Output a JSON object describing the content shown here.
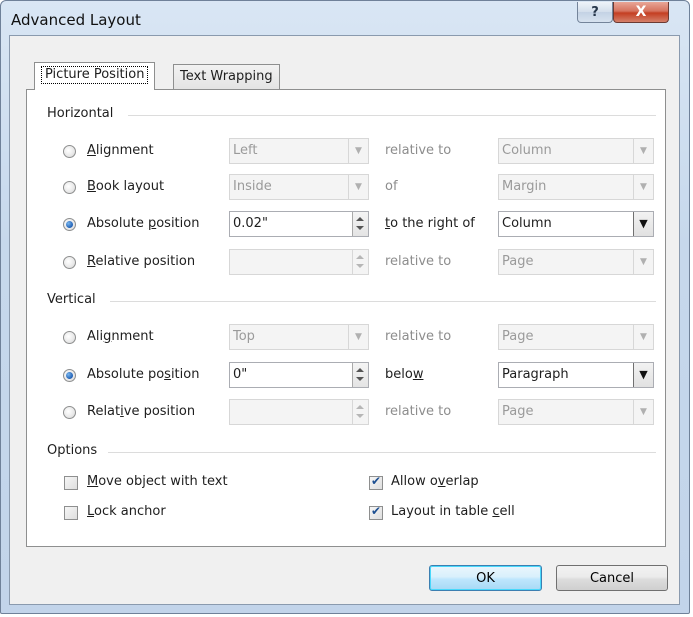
{
  "window": {
    "title": "Advanced Layout",
    "help_label": "?",
    "close_label": "X"
  },
  "tabs": [
    {
      "label": "Picture Position",
      "active": true
    },
    {
      "label": "Text Wrapping",
      "active": false
    }
  ],
  "horizontal": {
    "section_label": "Horizontal",
    "rows": [
      {
        "radio_label": "Alignment",
        "selected": false,
        "value": "Left",
        "relation": "relative to",
        "target": "Column",
        "enabled": false
      },
      {
        "radio_label": "Book layout",
        "selected": false,
        "value": "Inside",
        "relation": "of",
        "target": "Margin",
        "enabled": false
      },
      {
        "radio_label": "Absolute position",
        "selected": true,
        "value": "0.02\"",
        "relation": "to the right of",
        "target": "Column",
        "enabled": true
      },
      {
        "radio_label": "Relative position",
        "selected": false,
        "value": "",
        "relation": "relative to",
        "target": "Page",
        "enabled": false
      }
    ]
  },
  "vertical": {
    "section_label": "Vertical",
    "rows": [
      {
        "radio_label": "Alignment",
        "selected": false,
        "value": "Top",
        "relation": "relative to",
        "target": "Page",
        "enabled": false
      },
      {
        "radio_label": "Absolute position",
        "selected": true,
        "value": "0\"",
        "relation": "below",
        "target": "Paragraph",
        "enabled": true
      },
      {
        "radio_label": "Relative position",
        "selected": false,
        "value": "",
        "relation": "relative to",
        "target": "Page",
        "enabled": false
      }
    ]
  },
  "options": {
    "section_label": "Options",
    "move_object": {
      "label": "Move object with text",
      "checked": false
    },
    "lock_anchor": {
      "label": "Lock anchor",
      "checked": false
    },
    "allow_overlap": {
      "label": "Allow overlap",
      "checked": true
    },
    "layout_in_cell": {
      "label": "Layout in table cell",
      "checked": true
    }
  },
  "buttons": {
    "ok": "OK",
    "cancel": "Cancel"
  }
}
